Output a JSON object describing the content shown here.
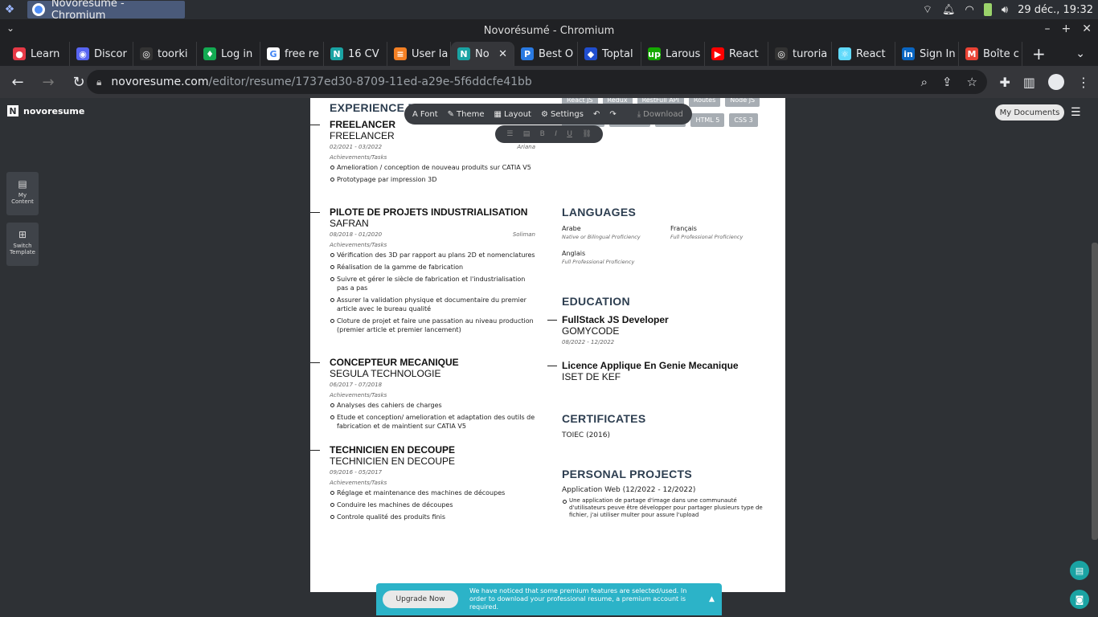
{
  "os": {
    "task_title": "Novorésumé - Chromium",
    "clock": "29 déc., 19:32"
  },
  "window": {
    "title": "Novorésumé - Chromium"
  },
  "tabs": [
    {
      "label": "Learn",
      "color": "#e63946",
      "glyph": "●"
    },
    {
      "label": "Discor",
      "color": "#5865f2",
      "glyph": "◉"
    },
    {
      "label": "toorki",
      "color": "#333333",
      "glyph": "◎"
    },
    {
      "label": "Log in",
      "color": "#13aa52",
      "glyph": "♦"
    },
    {
      "label": "free re",
      "color": "#ffffff",
      "glyph": "G"
    },
    {
      "label": "16 CV",
      "color": "#1aa3a3",
      "glyph": "N"
    },
    {
      "label": "User la",
      "color": "#f48024",
      "glyph": "≡"
    },
    {
      "label": "No",
      "color": "#1aa3a3",
      "glyph": "N"
    },
    {
      "label": "Best O",
      "color": "#2a7ae2",
      "glyph": "P"
    },
    {
      "label": "Toptal",
      "color": "#204ecf",
      "glyph": "◆"
    },
    {
      "label": "Larous",
      "color": "#14a800",
      "glyph": "up"
    },
    {
      "label": "React",
      "color": "#ff0000",
      "glyph": "▶"
    },
    {
      "label": "turoria",
      "color": "#333333",
      "glyph": "◎"
    },
    {
      "label": "React",
      "color": "#61dafb",
      "glyph": "⚛"
    },
    {
      "label": "Sign In",
      "color": "#0a66c2",
      "glyph": "in"
    },
    {
      "label": "Boîte c",
      "color": "#ea4335",
      "glyph": "M"
    }
  ],
  "address": {
    "host": "novoresume.com",
    "path": "/editor/resume/1737ed30-8709-11ed-a29e-5f6ddcfe41bb"
  },
  "app": {
    "brand": "novoresume",
    "my_content": "My Content",
    "switch_template": "Switch Template",
    "my_documents": "My Documents"
  },
  "toolbar": {
    "font": "Font",
    "theme": "Theme",
    "layout": "Layout",
    "settings": "Settings",
    "download": "Download"
  },
  "resume": {
    "experience_title": "EXPERIENCE P",
    "jobs": [
      {
        "title": "FREELANCER",
        "company": "FREELANCER",
        "dates": "02/2021 - 03/2022",
        "location": "Ariana",
        "ach_label": "Achievements/Tasks",
        "tasks": [
          "Amelioration / conception de nouveau produits sur CATIA V5",
          "Prototypage par impression 3D"
        ]
      },
      {
        "title": "PILOTE DE PROJETS INDUSTRIALISATION",
        "company": "SAFRAN",
        "dates": "08/2018 - 01/2020",
        "location": "Soliman",
        "ach_label": "Achievements/Tasks",
        "tasks": [
          "Vérification des 3D par rapport au plans 2D et nomenclatures",
          "Réalisation de la gamme de fabrication",
          "Suivre et gérer le siècle de fabrication et l'industrialisation pas a pas",
          "Assurer la validation physique et documentaire du premier article avec le bureau qualité",
          "Cloture de projet et faire une passation au niveau production (premier article et premier lancement)"
        ]
      },
      {
        "title": "CONCEPTEUR MECANIQUE",
        "company": "SEGULA TECHNOLOGIE",
        "dates": "06/2017 - 07/2018",
        "location": "",
        "ach_label": "Achievements/Tasks",
        "tasks": [
          "Analyses des cahiers de charges",
          "Etude et conception/ amelioration et adaptation des outils de fabrication et de maintient sur CATIA V5"
        ]
      },
      {
        "title": "TECHNICIEN EN DECOUPE",
        "company": "TECHNICIEN EN DECOUPE",
        "dates": "09/2016 - 05/2017",
        "location": "",
        "ach_label": "Achievements/Tasks",
        "tasks": [
          "Réglage et maintenance des machines de découpes",
          "Conduire les machines de découpes",
          "Controle qualité des produits finis"
        ]
      }
    ],
    "skills": [
      "React JS",
      "Redux",
      "RestFull API",
      "Routes",
      "Node JS",
      "Express JS",
      "MongoDB",
      "NoSQL",
      "HTML 5",
      "CSS 3"
    ],
    "languages_title": "LANGUAGES",
    "languages": [
      {
        "name": "Arabe",
        "level": "Native or Bilingual Proficiency"
      },
      {
        "name": "Français",
        "level": "Full Professional Proficiency"
      },
      {
        "name": "Anglais",
        "level": "Full Professional Proficiency"
      }
    ],
    "education_title": "EDUCATION",
    "education": [
      {
        "title": "FullStack JS Developer",
        "school": "GOMYCODE",
        "dates": "08/2022 - 12/2022"
      },
      {
        "title": "Licence Applique En Genie Mecanique",
        "school": "ISET DE KEF",
        "dates": ""
      }
    ],
    "certificates_title": "CERTIFICATES",
    "certificate": "TOIEC (2016)",
    "projects_title": "PERSONAL PROJECTS",
    "project_name": "Application Web (12/2022 - 12/2022)",
    "project_desc": "Une application de partage d'image dans une communauté d'utilisateurs peuve être développer pour partager plusieurs type de fichier, j'ai utiliser multer pour assure l'upload"
  },
  "banner": {
    "button": "Upgrade Now",
    "message": "We have noticed that some premium features are selected/used. In order to download your professional resume, a premium account is required."
  }
}
